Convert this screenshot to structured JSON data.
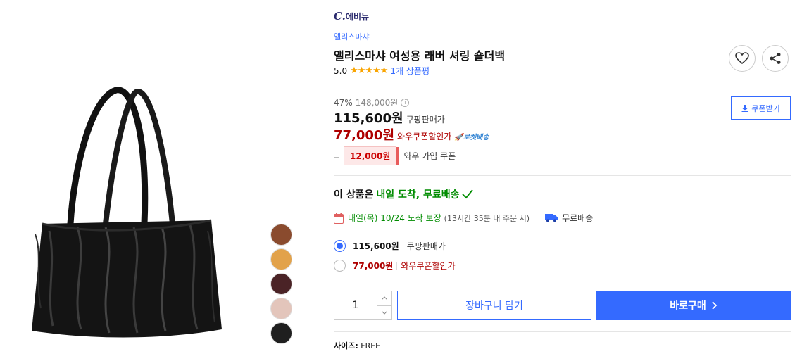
{
  "gallery": {
    "swatch_colors": [
      "#8a4b2e",
      "#e2a24a",
      "#4a2326",
      "#e3c5bb",
      "#1f1f1f"
    ]
  },
  "brand": {
    "logo_mark": "C.",
    "logo_text": "에비뉴"
  },
  "product": {
    "store_name": "앨리스마샤",
    "title": "앨리스마샤 여성용 래버 셔링 숄더백",
    "rating_score": "5.0",
    "star_count": 5,
    "review_count_label": "1개 상품평"
  },
  "actions": {
    "heart_icon": "heart-icon",
    "share_icon": "share-icon"
  },
  "pricing": {
    "discount_rate": "47%",
    "original_price": "148,000원",
    "sale_price": "115,600원",
    "sale_label": "쿠팡판매가",
    "wow_price": "77,000원",
    "wow_label": "와우쿠폰할인가",
    "rocket_label": "로켓배송",
    "coupon_amount": "12,000원",
    "coupon_text": "와우 가입 쿠폰",
    "coupon_button_label": "쿠폰받기"
  },
  "delivery": {
    "headline_prefix": "이 상품은",
    "headline_highlight": "내일 도착, 무료배송",
    "eta_main": "내일(목) 10/24 도착 보장",
    "eta_note": "(13시간 35분 내 주문 시)",
    "shipping_label": "무료배송"
  },
  "options": [
    {
      "price": "115,600원",
      "label": "쿠팡판매가",
      "selected": true
    },
    {
      "price": "77,000원",
      "label": "와우쿠폰할인가",
      "selected": false
    }
  ],
  "purchase": {
    "quantity": "1",
    "cart_label": "장바구니 담기",
    "buy_label": "바로구매"
  },
  "size": {
    "key": "사이즈:",
    "value": "FREE"
  },
  "colors": {
    "accent": "#346aff",
    "wow_red": "#ae0000",
    "delivery_green": "#008c00",
    "star": "#f9a400"
  }
}
